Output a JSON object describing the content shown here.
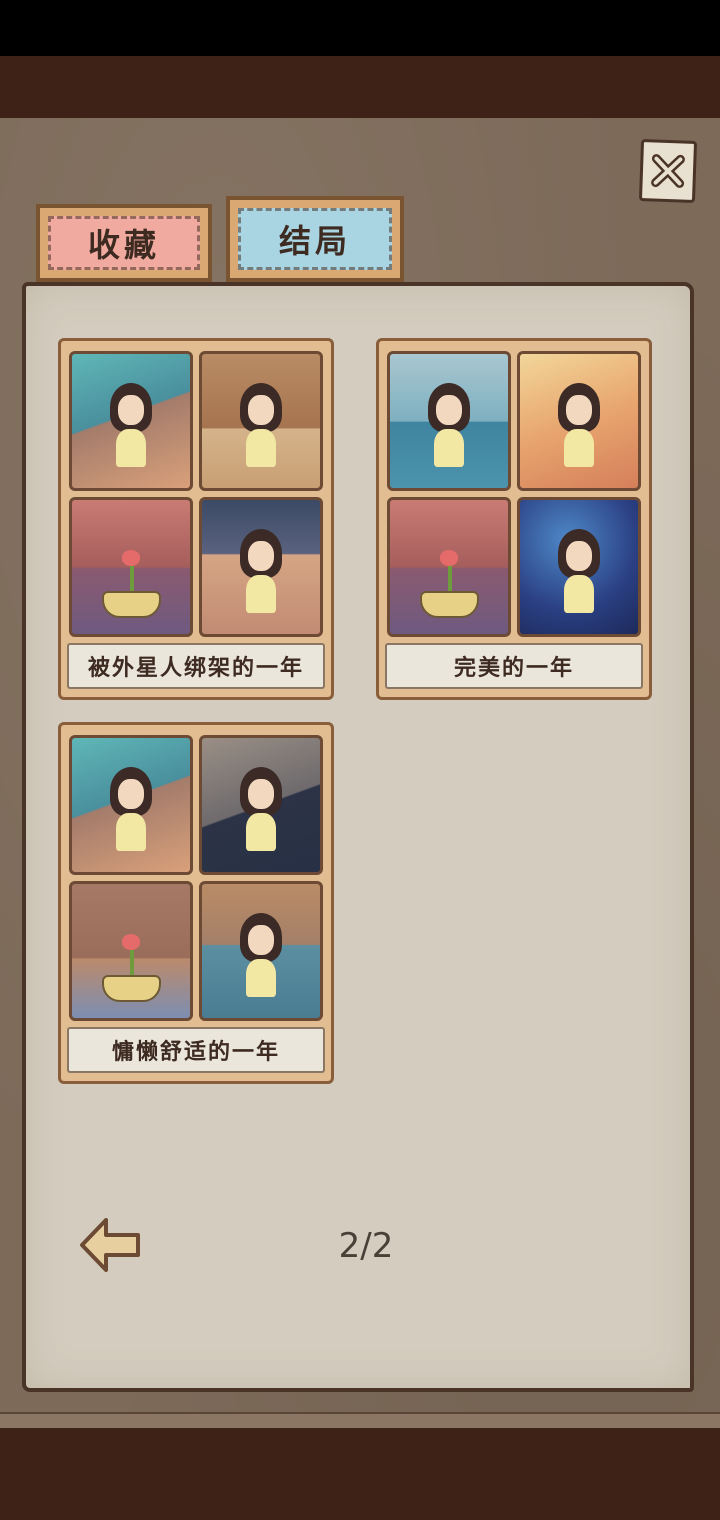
{
  "tabs": [
    {
      "label": "收藏",
      "active": false
    },
    {
      "label": "结局",
      "active": true
    }
  ],
  "close_icon": "close-icon",
  "endings": [
    {
      "title": "被外星人绑架的一年"
    },
    {
      "title": "完美的一年"
    },
    {
      "title": "慵懒舒适的一年"
    }
  ],
  "pagination": {
    "current": "2/2",
    "back_icon": "left-arrow-icon"
  },
  "colors": {
    "frame_brown": "#3e2217",
    "paper": "#d4cdbf",
    "tab_pink": "#f0aaa0",
    "tab_blue": "#a9d5e3",
    "card_wood": "#e1bd91"
  }
}
